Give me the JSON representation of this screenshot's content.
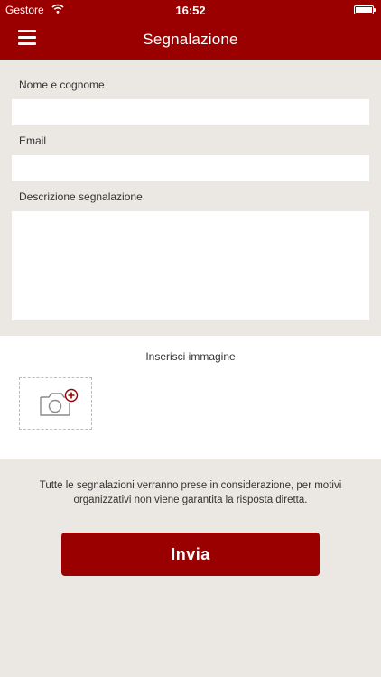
{
  "status_bar": {
    "carrier": "Gestore",
    "time": "16:52",
    "wifi_icon": "wifi-icon",
    "battery_icon": "battery-icon"
  },
  "nav": {
    "title": "Segnalazione",
    "menu_icon": "hamburger-menu-icon"
  },
  "form": {
    "name_label": "Nome e cognome",
    "name_value": "",
    "email_label": "Email",
    "email_value": "",
    "description_label": "Descrizione segnalazione",
    "description_value": ""
  },
  "image_section": {
    "label": "Inserisci immagine",
    "add_icon": "add-photo-camera-icon"
  },
  "disclaimer": "Tutte le segnalazioni verranno prese in considerazione, per motivi organizzativi non viene garantita la risposta diretta.",
  "submit_label": "Invia",
  "colors": {
    "brand": "#9b0000",
    "background": "#ebe7e2",
    "panel": "#ffffff"
  }
}
